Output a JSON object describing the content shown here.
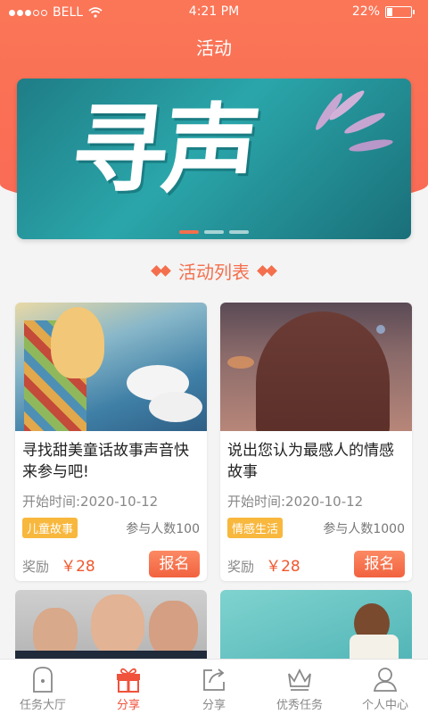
{
  "status_bar": {
    "carrier": "BELL",
    "time": "4:21 PM",
    "battery": "22%",
    "battery_level": 0.22
  },
  "header": {
    "title": "活动"
  },
  "banner": {
    "text": "寻声",
    "slides": 3,
    "active_slide": 0
  },
  "section": {
    "title": "活动列表"
  },
  "activities": [
    {
      "title": "寻找甜美童话故事声音快来参与吧!",
      "start_time": "开始时间:2020-10-12",
      "tag": "儿童故事",
      "participants": "参与人数100",
      "reward_label": "奖励",
      "reward": "￥28",
      "signup_label": "报名"
    },
    {
      "title": "说出您认为最感人的情感故事",
      "start_time": "开始时间:2020-10-12",
      "tag": "情感生活",
      "participants": "参与人数1000",
      "reward_label": "奖励",
      "reward": "￥28",
      "signup_label": "报名"
    }
  ],
  "tabbar": {
    "items": [
      {
        "label": "任务大厅",
        "icon": "home-icon"
      },
      {
        "label": "分享",
        "icon": "gift-icon",
        "active": true
      },
      {
        "label": "分享",
        "icon": "share-icon"
      },
      {
        "label": "优秀任务",
        "icon": "crown-icon"
      },
      {
        "label": "个人中心",
        "icon": "user-icon"
      }
    ]
  },
  "colors": {
    "accent": "#f46f4d",
    "tag": "#f8b73d",
    "active_tab": "#f0523c"
  }
}
